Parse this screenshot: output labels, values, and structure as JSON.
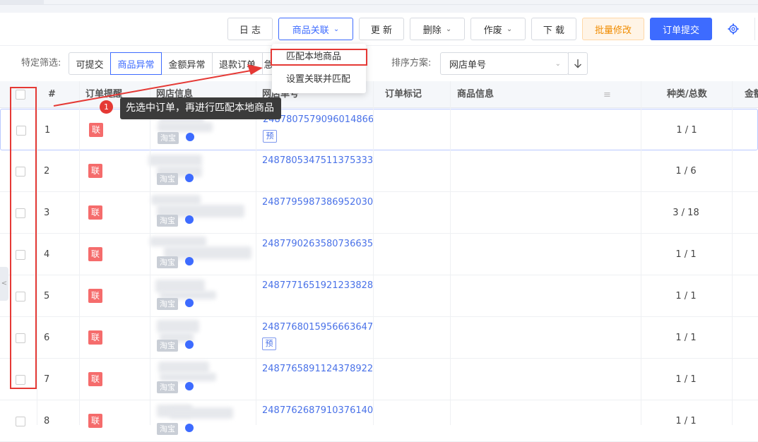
{
  "toolbar": {
    "log": "日 志",
    "relate": "商品关联",
    "update": "更 新",
    "delete": "删除",
    "void": "作废",
    "download": "下 载",
    "batch_edit": "批量修改",
    "submit": "订单提交",
    "settings_icon": "gear-icon"
  },
  "relate_menu": {
    "items": [
      "匹配本地商品",
      "设置关联并匹配"
    ]
  },
  "filter": {
    "label": "特定筛选:",
    "options": [
      "可提交",
      "商品异常",
      "金额异常",
      "退款订单",
      "急"
    ],
    "selected": "商品异常",
    "sort_label": "排序方案:",
    "sort_value": "网店单号"
  },
  "table": {
    "headers": [
      "#",
      "订单提醒",
      "网店信息",
      "网店单号",
      "订单标记",
      "商品信息",
      "种类/总数",
      "金额"
    ],
    "rows": [
      {
        "index": "1",
        "tag": "联",
        "platform": "淘宝",
        "order_no": "2487807579096014866",
        "pre": "预",
        "kinds": "1 / 1"
      },
      {
        "index": "2",
        "tag": "联",
        "platform": "淘宝",
        "order_no": "2487805347511375333",
        "pre": "",
        "kinds": "1 / 6"
      },
      {
        "index": "3",
        "tag": "联",
        "platform": "淘宝",
        "order_no": "2487795987386952030",
        "pre": "",
        "kinds": "3 / 18"
      },
      {
        "index": "4",
        "tag": "联",
        "platform": "淘宝",
        "order_no": "2487790263580736635",
        "pre": "",
        "kinds": "1 / 1"
      },
      {
        "index": "5",
        "tag": "联",
        "platform": "淘宝",
        "order_no": "2487771651921233828",
        "pre": "",
        "kinds": "1 / 1"
      },
      {
        "index": "6",
        "tag": "联",
        "platform": "淘宝",
        "order_no": "2487768015956663647",
        "pre": "预",
        "kinds": "1 / 1"
      },
      {
        "index": "7",
        "tag": "联",
        "platform": "淘宝",
        "order_no": "2487765891124378922",
        "pre": "",
        "kinds": "1 / 1"
      },
      {
        "index": "8",
        "tag": "联",
        "platform": "淘宝",
        "order_no": "2487762687910376140",
        "pre": "",
        "kinds": "1 / 1"
      }
    ]
  },
  "annotation": {
    "step": "1",
    "text": "先选中订单，再进行匹配本地商品",
    "color": "#e53935"
  },
  "colors": {
    "primary": "#3d6bff",
    "warn": "#f08c00",
    "tag_red": "#f56c6c"
  }
}
